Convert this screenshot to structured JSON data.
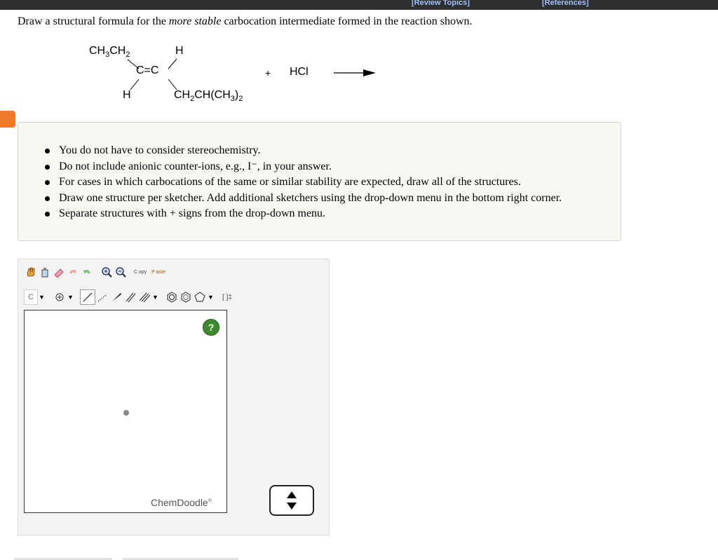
{
  "topbar": {
    "review_topics": "[Review Topics]",
    "references": "[References]"
  },
  "question": {
    "prefix": "Draw a structural formula for the ",
    "emphasis": "more stable",
    "suffix": " carbocation intermediate formed in the reaction shown."
  },
  "reaction": {
    "plus": "+",
    "reagent": "HCl"
  },
  "instructions": [
    "You do not have to consider stereochemistry.",
    "Do not include anionic counter-ions, e.g., I⁻, in your answer.",
    "For cases in which carbocations of the same or similar stability are expected, draw all of the structures.",
    "Draw one structure per sketcher. Add additional sketchers using the drop-down menu in the bottom right corner.",
    "Separate structures with + signs from the drop-down menu."
  ],
  "sketcher": {
    "element_label": "C",
    "copy_label": "C opy",
    "paste_label": "P aste",
    "template_label": "[ ]‡",
    "help_label": "?",
    "brand": "ChemDoodle",
    "brand_mark": "®"
  },
  "colors": {
    "accent_orange": "#ef7a2c",
    "link_blue": "#9ec3ff",
    "help_green": "#3e8a2e"
  }
}
